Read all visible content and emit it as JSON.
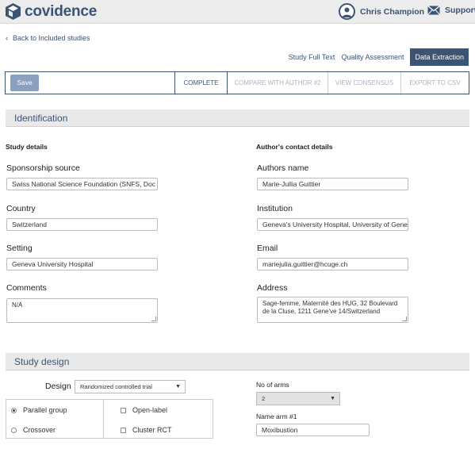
{
  "header": {
    "brand": "covidence",
    "user_name": "Chris Champion",
    "support_label": "Support"
  },
  "nav": {
    "back_label": "Back to Included studies",
    "tabs": [
      {
        "label": "Study Full Text",
        "active": false
      },
      {
        "label": "Quality Assessment",
        "active": false
      },
      {
        "label": "Data Extraction",
        "active": true
      }
    ]
  },
  "actions": {
    "save_label": "Save",
    "complete_label": "COMPLETE",
    "compare_label": "COMPARE WITH AUTHOR #2",
    "consensus_label": "VIEW CONSENSUS",
    "export_label": "EXPORT TO CSV"
  },
  "identification": {
    "title": "Identification",
    "study_details_heading": "Study details",
    "contact_heading": "Author's contact details",
    "sponsorship": {
      "label": "Sponsorship source",
      "value": "Swiss National Science Foundation (SNFS, Doc"
    },
    "country": {
      "label": "Country",
      "value": "Switzerland"
    },
    "setting": {
      "label": "Setting",
      "value": "Geneva University Hospital"
    },
    "comments": {
      "label": "Comments",
      "value": "N/A"
    },
    "authors_name": {
      "label": "Authors name",
      "value": "Marie-Jullia Guittier"
    },
    "institution": {
      "label": "Institution",
      "value": "Geneva's University Hospital, University of Geneva"
    },
    "email": {
      "label": "Email",
      "value": "mariejulia.guittier@hcuge.ch"
    },
    "address": {
      "label": "Address",
      "value": "Sage-femme, Maternité des HUG, 32 Boulevard de la Cluse, 1211 Gene've 14/Switzerland"
    }
  },
  "study_design": {
    "title": "Study design",
    "design_label": "Design",
    "design_value": "Randomized controlled trial",
    "options": {
      "parallel": "Parallel group",
      "crossover": "Crossover",
      "open_label": "Open-label",
      "cluster": "Cluster RCT"
    },
    "selected_option": "Parallel group",
    "no_of_arms_label": "No of arms",
    "no_of_arms_value": "2",
    "name_arm_label": "Name arm #1",
    "name_arm_value": "Moxibustion"
  },
  "colors": {
    "brand": "#3b5474",
    "save_button": "#8aa0bf",
    "section_bg": "#e9e9e9"
  }
}
